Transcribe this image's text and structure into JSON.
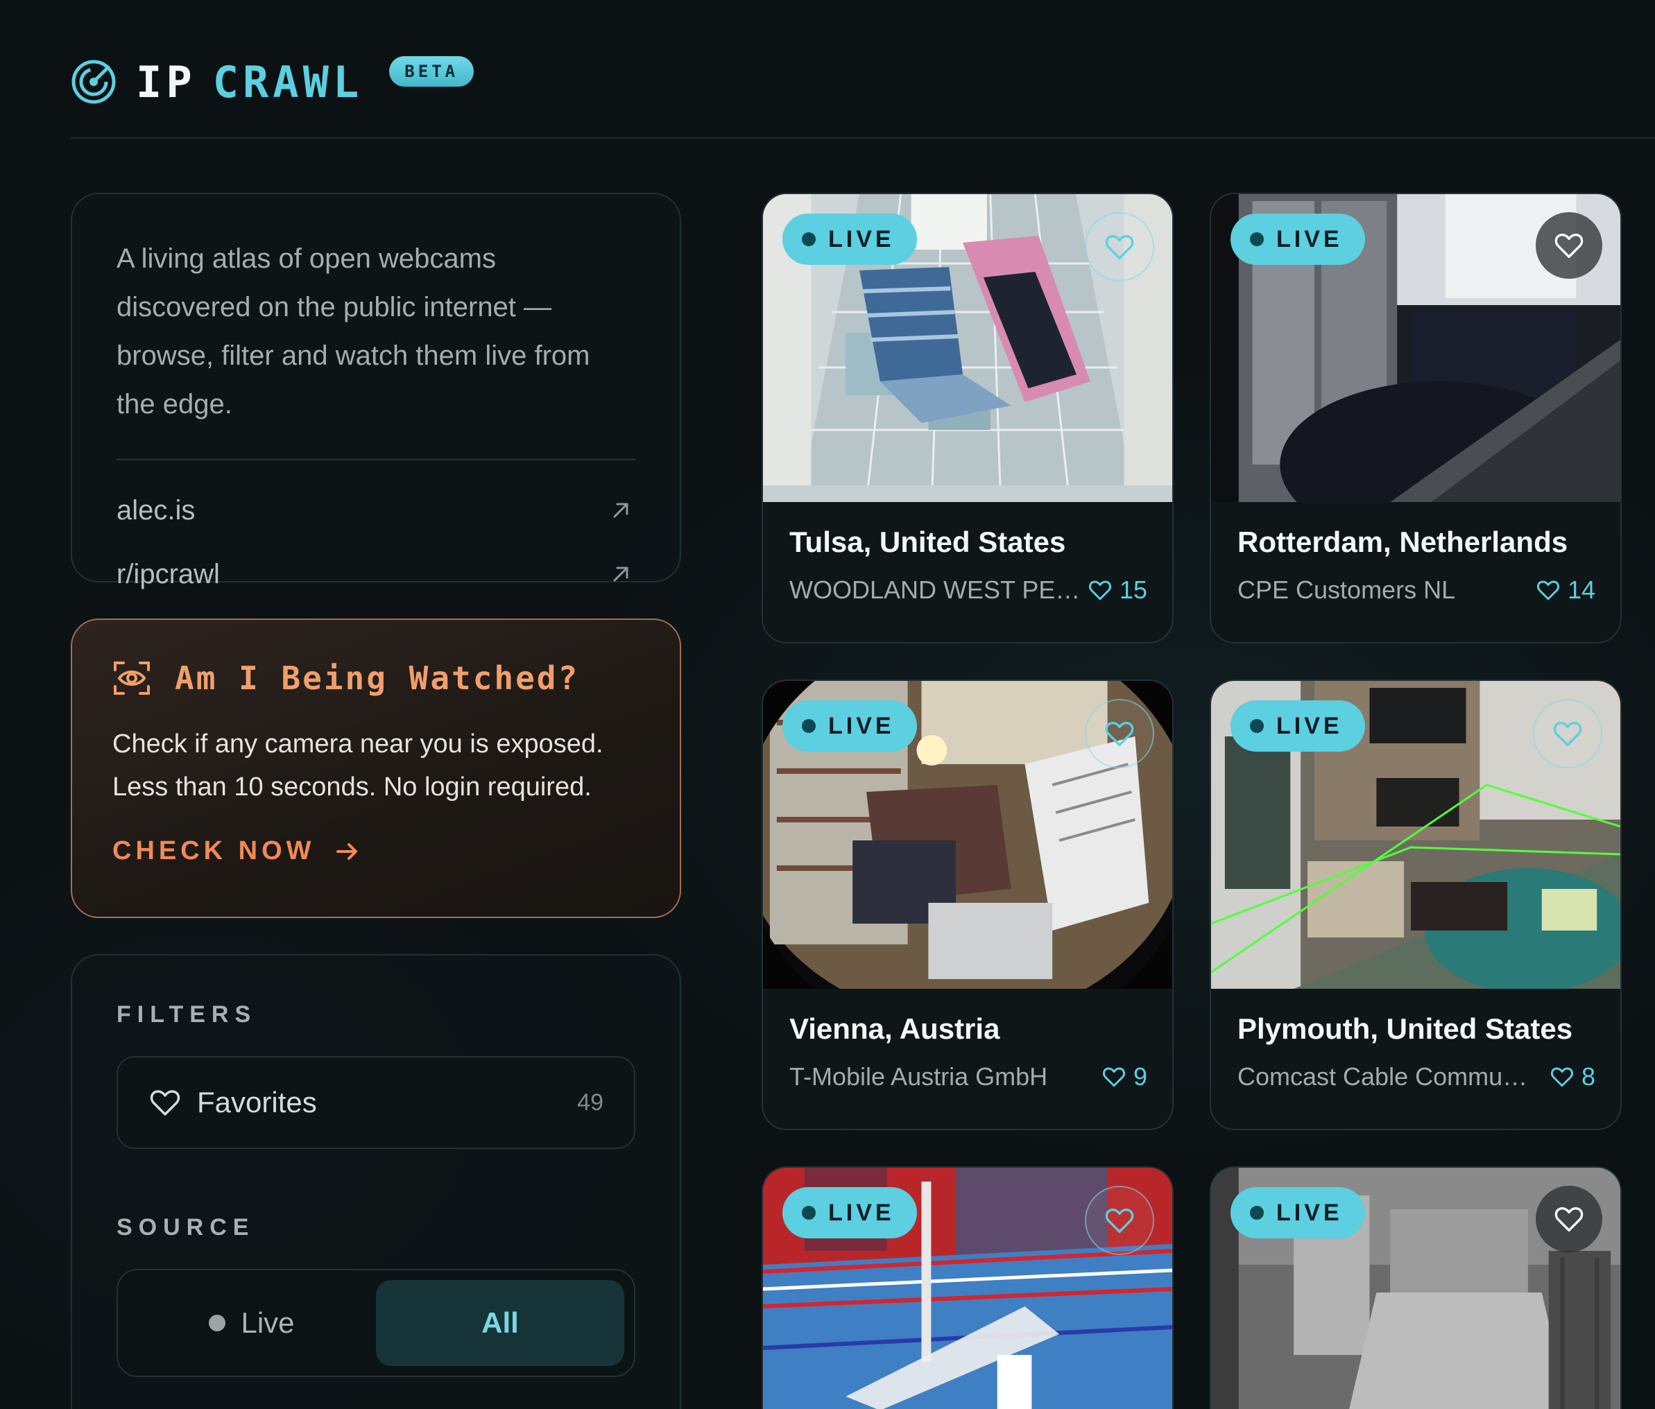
{
  "header": {
    "brand_ip": "IP",
    "brand_crawl": "CRAWL",
    "badge": "BETA"
  },
  "intro": {
    "text": "A living atlas of open webcams discovered on the public internet — browse, filter and watch them live from the edge.",
    "links": [
      {
        "label": "alec.is"
      },
      {
        "label": "r/ipcrawl"
      }
    ]
  },
  "watch": {
    "title": "Am I Being Watched?",
    "text": "Check if any camera near you is exposed. Less than 10 seconds. No login required.",
    "cta": "CHECK NOW"
  },
  "filters": {
    "label": "FILTERS",
    "favorites_label": "Favorites",
    "favorites_count": "49",
    "source_label": "SOURCE",
    "source_options": [
      {
        "label": "Live",
        "active": false
      },
      {
        "label": "All",
        "active": true
      }
    ]
  },
  "cards": [
    {
      "badge": "LIVE",
      "title": "Tulsa, United States",
      "isp": "WOODLAND WEST PET…",
      "likes": "15"
    },
    {
      "badge": "LIVE",
      "title": "Rotterdam, Netherlands",
      "isp": "CPE Customers NL",
      "likes": "14"
    },
    {
      "badge": "LIVE",
      "title": "Vienna, Austria",
      "isp": "T-Mobile Austria GmbH",
      "likes": "9"
    },
    {
      "badge": "LIVE",
      "title": "Plymouth, United States",
      "isp": "Comcast Cable Commu…",
      "likes": "8"
    },
    {
      "badge": "LIVE"
    },
    {
      "badge": "LIVE"
    }
  ],
  "colors": {
    "accent": "#5ccfe0",
    "warning": "#f08a58",
    "background": "#0c1113"
  }
}
